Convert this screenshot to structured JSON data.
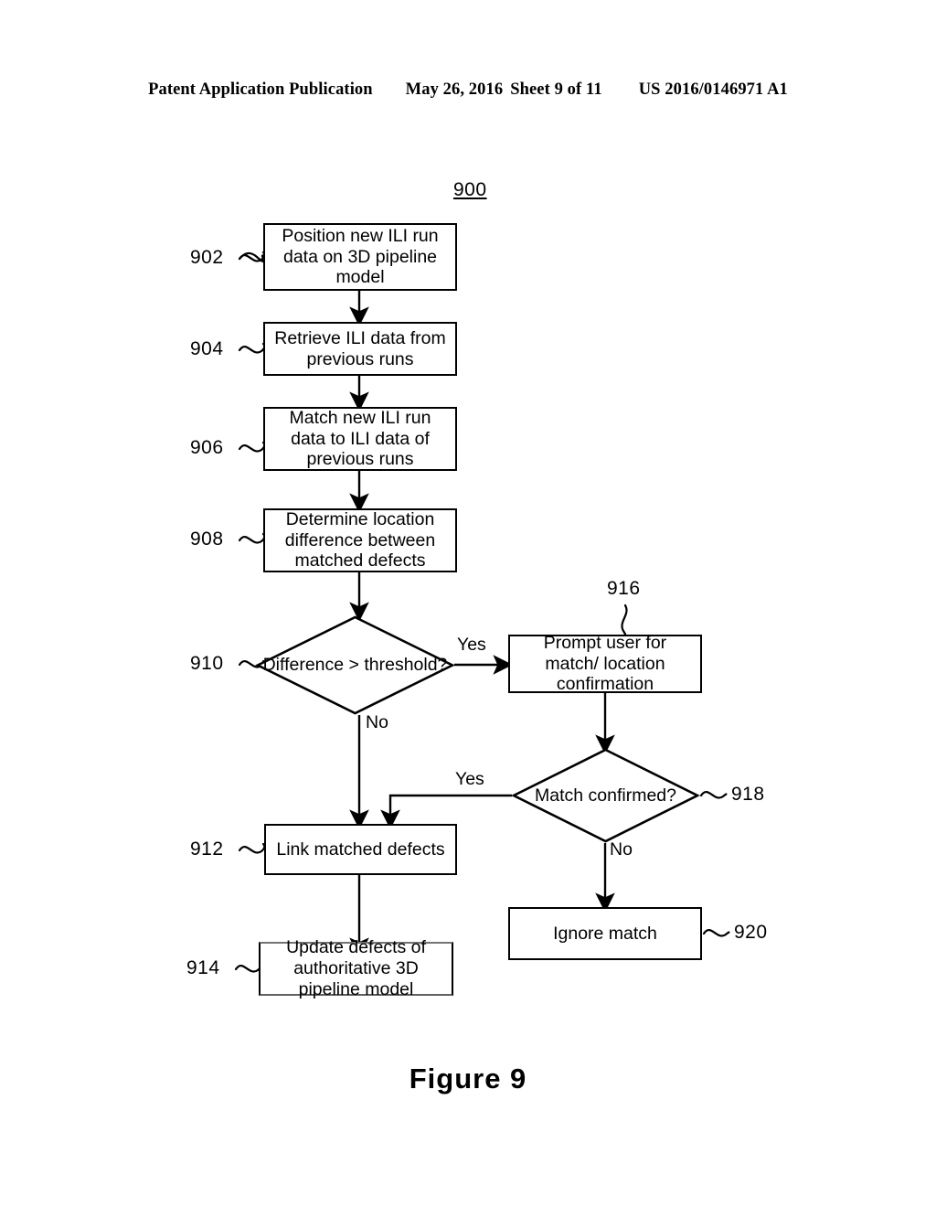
{
  "page_header": {
    "publication_type": "Patent Application Publication",
    "date": "May 26, 2016",
    "sheet": "Sheet 9 of 11",
    "publication_number": "US 2016/0146971 A1"
  },
  "figure": {
    "caption": "Figure  9",
    "diagram_number": "900"
  },
  "flowchart": {
    "nodes": [
      {
        "ref": "902",
        "type": "process",
        "text": "Position new ILI run data on 3D pipeline model"
      },
      {
        "ref": "904",
        "type": "process",
        "text": "Retrieve ILI data from previous runs"
      },
      {
        "ref": "906",
        "type": "process",
        "text": "Match new ILI run data to ILI data of previous runs"
      },
      {
        "ref": "908",
        "type": "process",
        "text": "Determine location difference between matched defects"
      },
      {
        "ref": "910",
        "type": "decision",
        "text": "Difference > threshold?"
      },
      {
        "ref": "912",
        "type": "process",
        "text": "Link matched defects"
      },
      {
        "ref": "914",
        "type": "process",
        "text": "Update defects of authoritative 3D pipeline model"
      },
      {
        "ref": "916",
        "type": "process",
        "text": "Prompt user for match/ location confirmation"
      },
      {
        "ref": "918",
        "type": "decision",
        "text": "Match confirmed?"
      },
      {
        "ref": "920",
        "type": "process",
        "text": "Ignore match"
      }
    ],
    "branch_labels": {
      "d910_yes": "Yes",
      "d910_no": "No",
      "d918_yes": "Yes",
      "d918_no": "No"
    }
  }
}
